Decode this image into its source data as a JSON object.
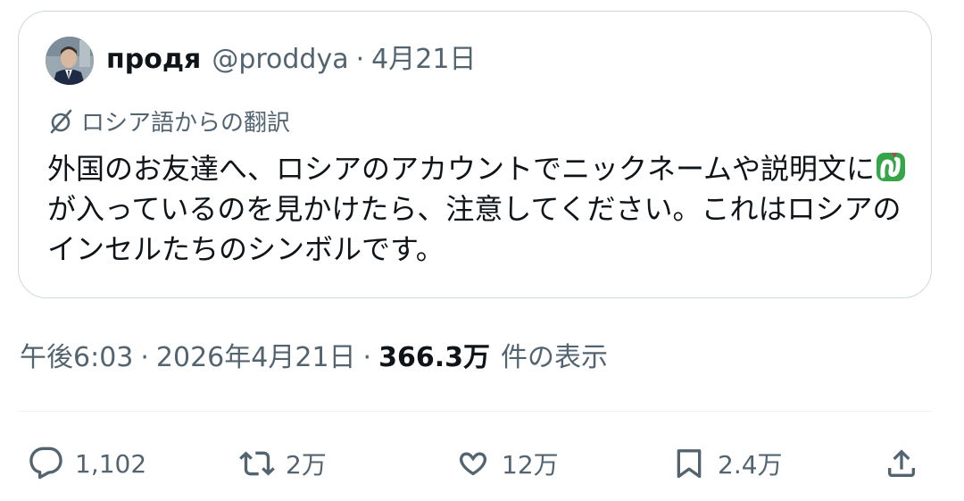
{
  "quoted_tweet": {
    "author_name": "продя",
    "author_handle": "@proddya",
    "separator": "·",
    "date": "4月21日",
    "translation_label": "ロシア語からの翻訳",
    "text_part1": "外国のお友達へ、ロシアのアカウントでニックネームや説明文に",
    "emoji": "snake-emoji",
    "text_part2": "が入っているのを見かけたら、注意してください。これはロシアのインセルたちのシンボルです。"
  },
  "tweet_meta": {
    "time": "午後6:03",
    "separator": "·",
    "date": "2026年4月21日",
    "views_count": "366.3万",
    "views_label": "件の表示"
  },
  "actions": {
    "reply": {
      "icon": "reply-icon",
      "count": "1,102"
    },
    "retweet": {
      "icon": "retweet-icon",
      "count": "2万"
    },
    "like": {
      "icon": "heart-icon",
      "count": "12万"
    },
    "bookmark": {
      "icon": "bookmark-icon",
      "count": "2.4万"
    },
    "share": {
      "icon": "share-icon"
    }
  },
  "colors": {
    "text_primary": "#0f1419",
    "text_secondary": "#536471",
    "border": "#cfd9de",
    "snake_green": "#35a548"
  }
}
